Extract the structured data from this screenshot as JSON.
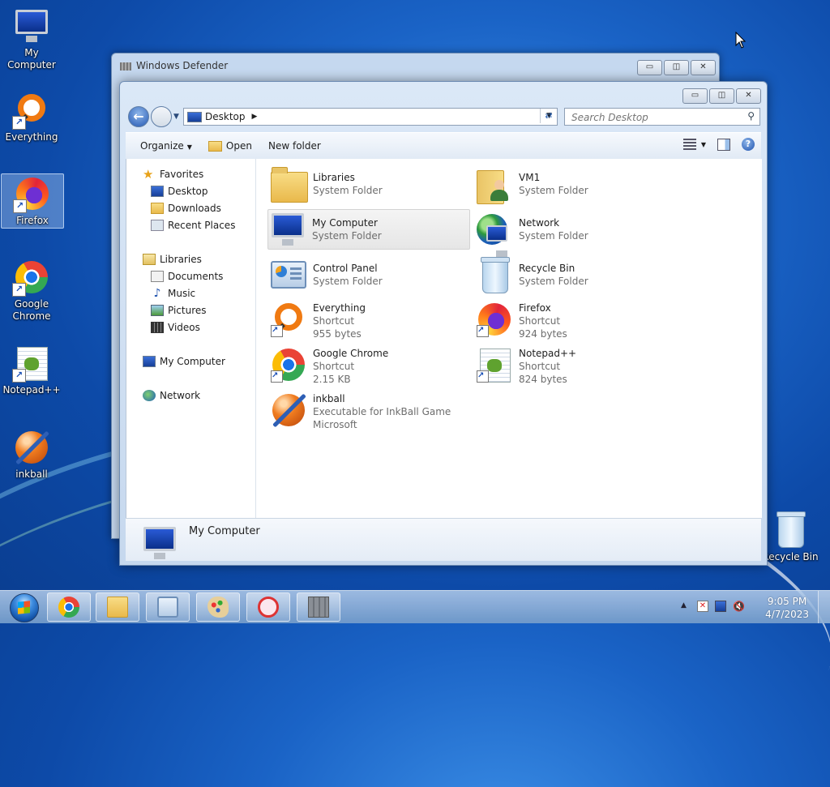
{
  "desktop": {
    "icons": [
      {
        "label": "My Computer",
        "icon": "computer-icon",
        "shortcut": false
      },
      {
        "label": "Everything",
        "icon": "everything-icon",
        "shortcut": true
      },
      {
        "label": "Firefox",
        "icon": "firefox-icon",
        "shortcut": true,
        "selected": true
      },
      {
        "label": "Google Chrome",
        "icon": "chrome-icon",
        "shortcut": true
      },
      {
        "label": "Notepad++",
        "icon": "notepadpp-icon",
        "shortcut": true
      },
      {
        "label": "inkball",
        "icon": "inkball-icon",
        "shortcut": false
      },
      {
        "label": "Recycle Bin",
        "icon": "recycle-bin-icon",
        "shortcut": false
      }
    ]
  },
  "bg_window": {
    "title": "Windows Defender",
    "buttons": {
      "minimize": "▭",
      "maximize": "◫",
      "close": "✕"
    }
  },
  "explorer": {
    "buttons": {
      "minimize": "▭",
      "maximize": "◫",
      "close": "✕"
    },
    "address": {
      "path": "Desktop"
    },
    "search": {
      "placeholder": "Search Desktop"
    },
    "toolbar": {
      "organize": "Organize",
      "open": "Open",
      "new_folder": "New folder"
    },
    "nav": {
      "favorites": {
        "label": "Favorites",
        "items": [
          "Desktop",
          "Downloads",
          "Recent Places"
        ]
      },
      "libraries": {
        "label": "Libraries",
        "items": [
          "Documents",
          "Music",
          "Pictures",
          "Videos"
        ]
      },
      "computer": "My Computer",
      "network": "Network"
    },
    "items": [
      {
        "name": "Libraries",
        "sub1": "System Folder",
        "sub2": "",
        "icon": "libraries-icon",
        "shortcut": false
      },
      {
        "name": "VM1",
        "sub1": "System Folder",
        "sub2": "",
        "icon": "user-folder-icon",
        "shortcut": false
      },
      {
        "name": "My Computer",
        "sub1": "System Folder",
        "sub2": "",
        "icon": "computer-icon",
        "shortcut": false,
        "selected": true
      },
      {
        "name": "Network",
        "sub1": "System Folder",
        "sub2": "",
        "icon": "network-icon",
        "shortcut": false
      },
      {
        "name": "Control Panel",
        "sub1": "System Folder",
        "sub2": "",
        "icon": "control-panel-icon",
        "shortcut": false
      },
      {
        "name": "Recycle Bin",
        "sub1": "System Folder",
        "sub2": "",
        "icon": "recycle-bin-icon",
        "shortcut": false
      },
      {
        "name": "Everything",
        "sub1": "Shortcut",
        "sub2": "955 bytes",
        "icon": "everything-icon",
        "shortcut": true
      },
      {
        "name": "Firefox",
        "sub1": "Shortcut",
        "sub2": "924 bytes",
        "icon": "firefox-icon",
        "shortcut": true
      },
      {
        "name": "Google Chrome",
        "sub1": "Shortcut",
        "sub2": "2.15 KB",
        "icon": "chrome-icon",
        "shortcut": true
      },
      {
        "name": "Notepad++",
        "sub1": "Shortcut",
        "sub2": "824 bytes",
        "icon": "notepadpp-icon",
        "shortcut": true
      },
      {
        "name": "inkball",
        "sub1": "Executable for InkBall Game",
        "sub2": "Microsoft",
        "icon": "inkball-icon",
        "shortcut": false
      }
    ],
    "details": {
      "name": "My Computer"
    }
  },
  "taskbar": {
    "apps": [
      "chrome-icon",
      "explorer-icon",
      "control-panel-icon",
      "paint-icon",
      "snipping-tool-icon",
      "castle-icon"
    ],
    "clock": {
      "time": "9:05 PM",
      "date": "4/7/2023"
    }
  }
}
